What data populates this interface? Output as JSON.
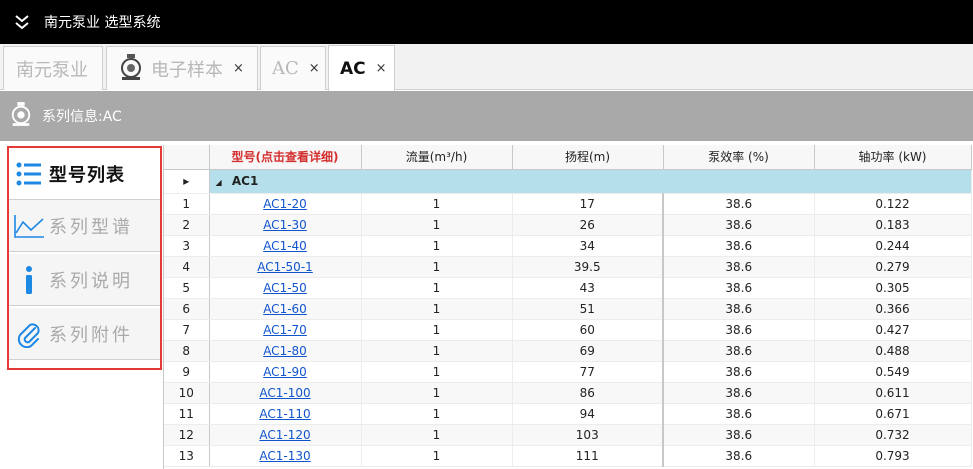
{
  "window": {
    "title": "南元泵业 选型系统"
  },
  "tabs": [
    {
      "label": "南元泵业",
      "closable": false
    },
    {
      "label": "电子样本",
      "closable": true,
      "icon": "pump-icon"
    },
    {
      "label": "AC",
      "closable": true
    },
    {
      "label": "AC",
      "closable": true,
      "active": true
    }
  ],
  "close_glyph": "×",
  "info_bar": {
    "label": "系列信息:AC"
  },
  "sidebar": {
    "items": [
      {
        "label": "型号列表",
        "icon": "list-icon",
        "active": true
      },
      {
        "label": "系列型谱",
        "icon": "chart-icon"
      },
      {
        "label": "系列说明",
        "icon": "info-icon"
      },
      {
        "label": "系列附件",
        "icon": "paperclip-icon"
      }
    ]
  },
  "grid": {
    "columns": [
      "型号(点击查看详细)",
      "流量(m³/h)",
      "扬程(m)",
      "泵效率 (%)",
      "轴功率 (kW)"
    ],
    "group": {
      "toggle": "◢",
      "label": "AC1"
    },
    "rows": [
      {
        "no": "1",
        "model": "AC1-20",
        "flow": "1",
        "head": "17",
        "eff": "38.6",
        "power": "0.122"
      },
      {
        "no": "2",
        "model": "AC1-30",
        "flow": "1",
        "head": "26",
        "eff": "38.6",
        "power": "0.183"
      },
      {
        "no": "3",
        "model": "AC1-40",
        "flow": "1",
        "head": "34",
        "eff": "38.6",
        "power": "0.244"
      },
      {
        "no": "4",
        "model": "AC1-50-1",
        "flow": "1",
        "head": "39.5",
        "eff": "38.6",
        "power": "0.279"
      },
      {
        "no": "5",
        "model": "AC1-50",
        "flow": "1",
        "head": "43",
        "eff": "38.6",
        "power": "0.305"
      },
      {
        "no": "6",
        "model": "AC1-60",
        "flow": "1",
        "head": "51",
        "eff": "38.6",
        "power": "0.366"
      },
      {
        "no": "7",
        "model": "AC1-70",
        "flow": "1",
        "head": "60",
        "eff": "38.6",
        "power": "0.427"
      },
      {
        "no": "8",
        "model": "AC1-80",
        "flow": "1",
        "head": "69",
        "eff": "38.6",
        "power": "0.488"
      },
      {
        "no": "9",
        "model": "AC1-90",
        "flow": "1",
        "head": "77",
        "eff": "38.6",
        "power": "0.549"
      },
      {
        "no": "10",
        "model": "AC1-100",
        "flow": "1",
        "head": "86",
        "eff": "38.6",
        "power": "0.611"
      },
      {
        "no": "11",
        "model": "AC1-110",
        "flow": "1",
        "head": "94",
        "eff": "38.6",
        "power": "0.671"
      },
      {
        "no": "12",
        "model": "AC1-120",
        "flow": "1",
        "head": "103",
        "eff": "38.6",
        "power": "0.732"
      },
      {
        "no": "13",
        "model": "AC1-130",
        "flow": "1",
        "head": "111",
        "eff": "38.6",
        "power": "0.793"
      }
    ]
  },
  "colors": {
    "accent_red": "#e53935",
    "group_row": "#b4dfeb",
    "link": "#1155cc",
    "titlebar": "#000000"
  }
}
